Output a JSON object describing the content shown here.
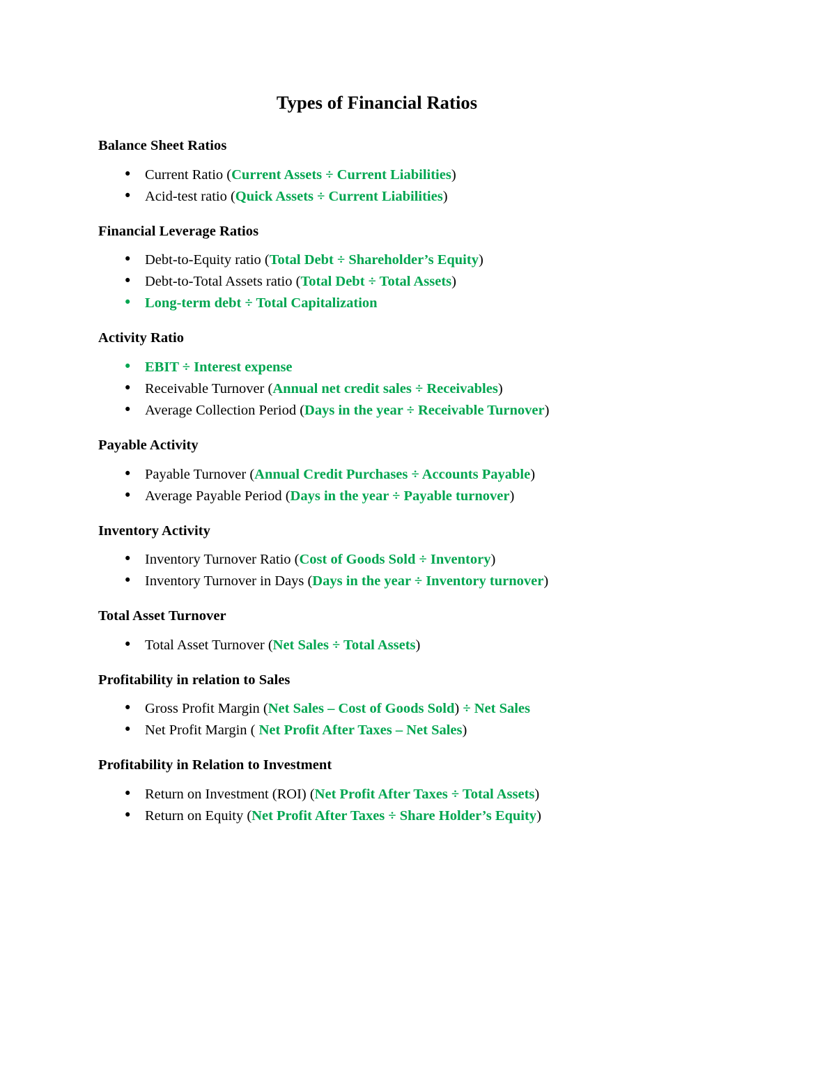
{
  "document": {
    "title": "Types of Financial Ratios",
    "accent_color": "#00a550",
    "text_color": "#000000",
    "background_color": "#ffffff",
    "bullet_glyph": "•"
  },
  "sections": [
    {
      "heading": "Balance Sheet Ratios",
      "items": [
        {
          "bullet_color": "#000000",
          "parts": [
            {
              "text": "Current Ratio (",
              "style": "black"
            },
            {
              "text": "Current Assets ÷ Current Liabilities",
              "style": "green"
            },
            {
              "text": ")",
              "style": "black"
            }
          ]
        },
        {
          "bullet_color": "#000000",
          "parts": [
            {
              "text": "Acid-test ratio (",
              "style": "black"
            },
            {
              "text": "Quick Assets ÷ Current Liabilities",
              "style": "green"
            },
            {
              "text": ")",
              "style": "black"
            }
          ]
        }
      ]
    },
    {
      "heading": "Financial Leverage Ratios",
      "items": [
        {
          "bullet_color": "#000000",
          "parts": [
            {
              "text": "Debt-to-Equity ratio (",
              "style": "black"
            },
            {
              "text": "Total Debt ÷ Shareholder’s Equity",
              "style": "green"
            },
            {
              "text": ")",
              "style": "black"
            }
          ]
        },
        {
          "bullet_color": "#000000",
          "parts": [
            {
              "text": "Debt-to-Total Assets ratio (",
              "style": "black"
            },
            {
              "text": "Total Debt ÷ Total Assets",
              "style": "green"
            },
            {
              "text": ")",
              "style": "black"
            }
          ]
        },
        {
          "bullet_color": "#00a550",
          "parts": [
            {
              "text": "Long-term debt ÷ Total Capitalization",
              "style": "green"
            }
          ]
        }
      ]
    },
    {
      "heading": "Activity Ratio",
      "items": [
        {
          "bullet_color": "#00a550",
          "parts": [
            {
              "text": "EBIT ÷ Interest expense",
              "style": "green"
            }
          ]
        },
        {
          "bullet_color": "#000000",
          "parts": [
            {
              "text": "Receivable Turnover (",
              "style": "black"
            },
            {
              "text": "Annual net credit sales ÷ Receivables",
              "style": "green"
            },
            {
              "text": ")",
              "style": "black"
            }
          ]
        },
        {
          "bullet_color": "#000000",
          "parts": [
            {
              "text": "Average Collection Period (",
              "style": "black"
            },
            {
              "text": "Days in the year ÷ Receivable Turnover",
              "style": "green"
            },
            {
              "text": ")",
              "style": "black"
            }
          ]
        }
      ]
    },
    {
      "heading": "Payable Activity",
      "items": [
        {
          "bullet_color": "#000000",
          "parts": [
            {
              "text": "Payable Turnover (",
              "style": "black"
            },
            {
              "text": "Annual Credit Purchases ÷ Accounts Payable",
              "style": "green"
            },
            {
              "text": ")",
              "style": "black"
            }
          ]
        },
        {
          "bullet_color": "#000000",
          "parts": [
            {
              "text": "Average Payable Period (",
              "style": "black"
            },
            {
              "text": "Days in the year ÷ Payable turnover",
              "style": "green"
            },
            {
              "text": ")",
              "style": "black"
            }
          ]
        }
      ]
    },
    {
      "heading": "Inventory Activity",
      "items": [
        {
          "bullet_color": "#000000",
          "parts": [
            {
              "text": "Inventory Turnover Ratio (",
              "style": "black"
            },
            {
              "text": "Cost of Goods Sold ÷ Inventory",
              "style": "green"
            },
            {
              "text": ")",
              "style": "black"
            }
          ]
        },
        {
          "bullet_color": "#000000",
          "parts": [
            {
              "text": "Inventory Turnover in Days (",
              "style": "black"
            },
            {
              "text": "Days in the year ÷ Inventory turnover",
              "style": "green"
            },
            {
              "text": ")",
              "style": "black"
            }
          ]
        }
      ]
    },
    {
      "heading": "Total Asset Turnover",
      "items": [
        {
          "bullet_color": "#000000",
          "parts": [
            {
              "text": "Total Asset Turnover (",
              "style": "black"
            },
            {
              "text": "Net Sales ÷ Total Assets",
              "style": "green"
            },
            {
              "text": ")",
              "style": "black"
            }
          ]
        }
      ]
    },
    {
      "heading": "Profitability in relation to Sales",
      "items": [
        {
          "bullet_color": "#000000",
          "parts": [
            {
              "text": "Gross Profit Margin (",
              "style": "black"
            },
            {
              "text": "Net Sales – Cost of Goods Sold",
              "style": "green"
            },
            {
              "text": ")",
              "style": "black"
            },
            {
              "text": " ÷ Net Sales",
              "style": "green"
            }
          ]
        },
        {
          "bullet_color": "#000000",
          "parts": [
            {
              "text": "Net Profit Margin ( ",
              "style": "black"
            },
            {
              "text": "Net Profit After Taxes – Net Sales",
              "style": "green"
            },
            {
              "text": ")",
              "style": "black"
            }
          ]
        }
      ]
    },
    {
      "heading": "Profitability in Relation to Investment",
      "items": [
        {
          "bullet_color": "#000000",
          "parts": [
            {
              "text": "Return on Investment (ROI) (",
              "style": "black"
            },
            {
              "text": "Net Profit After Taxes ÷ Total Assets",
              "style": "green"
            },
            {
              "text": ")",
              "style": "black"
            }
          ]
        },
        {
          "bullet_color": "#000000",
          "parts": [
            {
              "text": "Return on Equity (",
              "style": "black"
            },
            {
              "text": "Net Profit After Taxes ÷ Share Holder’s Equity",
              "style": "green"
            },
            {
              "text": ")",
              "style": "black"
            }
          ]
        }
      ]
    }
  ]
}
